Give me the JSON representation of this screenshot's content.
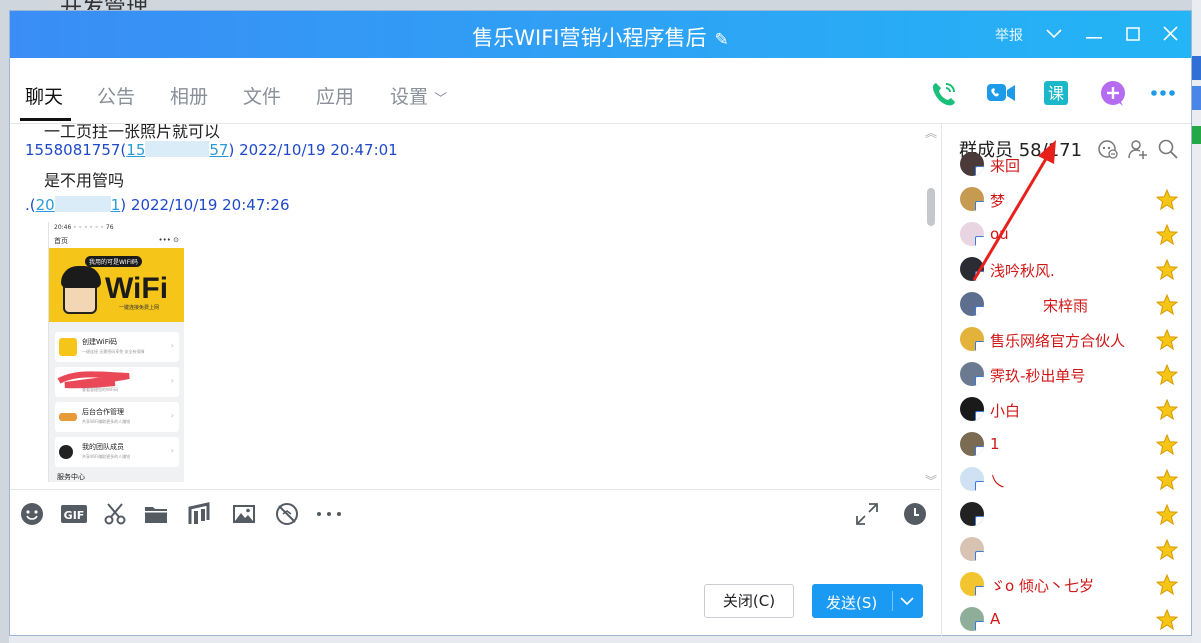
{
  "background": {
    "title_fragment": "开发管理"
  },
  "window": {
    "title": "售乐WIFI营销小程序售后",
    "report_label": "举报"
  },
  "tabs": [
    {
      "label": "聊天"
    },
    {
      "label": "公告"
    },
    {
      "label": "相册"
    },
    {
      "label": "文件"
    },
    {
      "label": "应用"
    },
    {
      "label": "设置"
    }
  ],
  "chat": {
    "partial_line": "一工页拄一张照片就可以",
    "messages": [
      {
        "sender_prefix": "1558081757(",
        "sender_num_start": "15",
        "sender_num_end": "57",
        "sender_suffix": ")",
        "timestamp": "2022/10/19 20:47:01",
        "text": "是不用管吗"
      },
      {
        "sender_prefix": ".(",
        "sender_num_start": "20",
        "sender_num_end": "1",
        "sender_suffix": ")",
        "timestamp": "2022/10/19 20:47:26"
      }
    ],
    "screenshot": {
      "statusbar": "20:46 ◦ ◦ ◦ ◦ ◦ ◦ 76",
      "nav_title": "首页",
      "nav_right": "••• ⊙",
      "banner_tag": "我用的可是WIFI码",
      "banner_word": "WiFi",
      "banner_sub": "一键连接免费上网",
      "cards": [
        {
          "title": "创建WiFi码",
          "desc": "一键连接 无需密码享免 安全有保障"
        },
        {
          "title": "",
          "desc": "查看管理您的WiFi码"
        },
        {
          "title": "后台合作管理",
          "desc": "共享WiFi赚取更多的人赚钱"
        },
        {
          "title": "我的团队成员",
          "desc": "共享WiFi赚取更多的人赚钱"
        }
      ],
      "footer": "服务中心"
    }
  },
  "buttons": {
    "close_label": "关闭(C)",
    "send_label": "发送(S)"
  },
  "members": {
    "header": "群成员 58/171",
    "list": [
      {
        "name": "来回"
      },
      {
        "name": "梦"
      },
      {
        "name": "ou"
      },
      {
        "name": "浅吟秋风."
      },
      {
        "name": "宋梓雨"
      },
      {
        "name": "售乐网络官方合伙人"
      },
      {
        "name": "霁玖-秒出单号"
      },
      {
        "name": "小白"
      },
      {
        "name": "1"
      },
      {
        "name": "乀"
      },
      {
        "name": ""
      },
      {
        "name": ""
      },
      {
        "name": "ゞo 倾心丶七岁"
      },
      {
        "name": "A"
      }
    ]
  },
  "colors": {
    "titlebar_start": "#3a8df5",
    "titlebar_end": "#23b5f5",
    "member_name": "#d01818",
    "send_button": "#1a9af2",
    "annotation_arrow": "#e8201c"
  }
}
